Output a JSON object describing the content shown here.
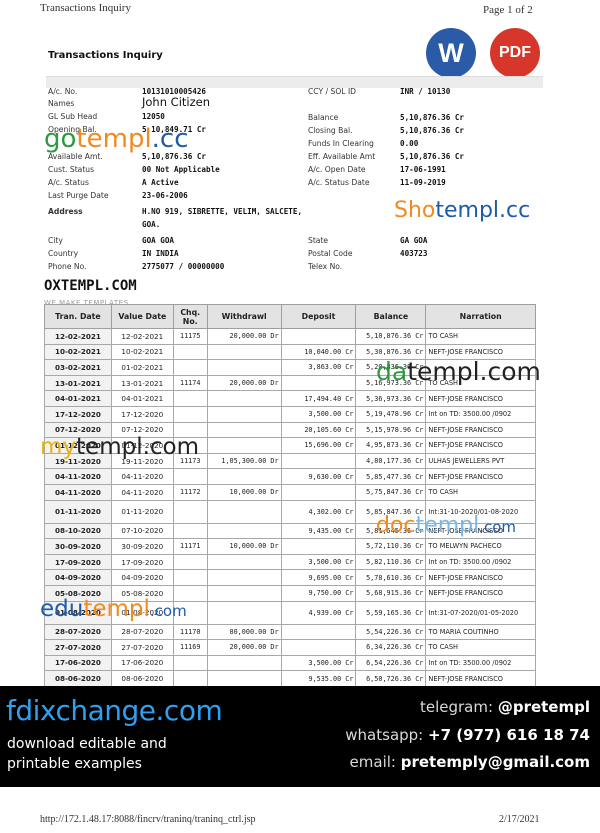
{
  "page": {
    "header": "Transactions Inquiry",
    "page_label": "Page 1 of 2",
    "footer_url": "http://172.1.48.17:8088/fincrv/traninq/traninq_ctrl.jsp",
    "footer_date": "2/17/2021"
  },
  "badges": {
    "word": "W",
    "pdf": "PDF"
  },
  "document": {
    "title": "Transactions Inquiry",
    "left": [
      {
        "label": "A/c. No.",
        "value": "10131010005426"
      },
      {
        "label": "Names",
        "value": "John Citizen"
      },
      {
        "label": "GL Sub Head",
        "value": "12050"
      },
      {
        "label": "Opening Bal.",
        "value": "5,10,849.71 Cr"
      },
      {
        "label": "Available Amt.",
        "value": "5,10,876.36 Cr"
      },
      {
        "label": "Cust. Status",
        "value": "00 Not Applicable"
      },
      {
        "label": "A/c. Status",
        "value": "A Active"
      },
      {
        "label": "Last Purge Date",
        "value": "23-06-2006"
      },
      {
        "label": "Address",
        "value": "H.NO 919, SIBRETTE, VELIM, SALCETE,"
      },
      {
        "label": "",
        "value": "GOA."
      },
      {
        "label": "City",
        "value": "GOA   GOA"
      },
      {
        "label": "Country",
        "value": "IN   INDIA"
      },
      {
        "label": "Phone No.",
        "value": "2775077 / 00000000"
      }
    ],
    "right": [
      {
        "label": "CCY / SOL ID",
        "value": "INR / 10130"
      },
      {
        "label": "Balance",
        "value": "5,10,876.36 Cr"
      },
      {
        "label": "Closing Bal.",
        "value": "5,10,876.36 Cr"
      },
      {
        "label": "Funds In Clearing",
        "value": "0.00"
      },
      {
        "label": "Eff. Available Amt",
        "value": "5,10,876.36 Cr"
      },
      {
        "label": "A/c. Open Date",
        "value": "17-06-1991"
      },
      {
        "label": "A/c. Status Date",
        "value": "11-09-2019"
      },
      {
        "label": "State",
        "value": "GA   GOA"
      },
      {
        "label": "Postal Code",
        "value": "403723"
      },
      {
        "label": "Telex No.",
        "value": ""
      }
    ]
  },
  "watermarks": {
    "gotempl_a": "go",
    "gotempl_b": "templ",
    "gotempl_c": ".cc",
    "shotempl_a": "Sho",
    "shotempl_b": "templ.cc",
    "oxtempl": "OXTEMPL.COM",
    "we_make": "WE MAKE TEMPLATES",
    "datempl_a": "da",
    "datempl_b": "templ.com",
    "mytempl_a": "my",
    "mytempl_b": "templ.com",
    "doctempl_a": "doc",
    "doctempl_b": "templ",
    "doctempl_c": ".com",
    "edutempl_a": "edu",
    "edutempl_b": "templ",
    "edutempl_c": ".com"
  },
  "table": {
    "headers": [
      "Tran. Date",
      "Value Date",
      "Chq. No.",
      "Withdrawl",
      "Deposit",
      "Balance",
      "Narration"
    ],
    "rows": [
      {
        "tran": "12-02-2021",
        "value": "12-02-2021",
        "chq": "11175",
        "wd": "20,000.00 Dr",
        "dep": "",
        "bal": "5,10,876.36 Cr",
        "narr": "TO CASH"
      },
      {
        "tran": "10-02-2021",
        "value": "10-02-2021",
        "chq": "",
        "wd": "",
        "dep": "10,040.00 Cr",
        "bal": "5,30,876.36 Cr",
        "narr": "NEFT-JOSE FRANCISCO"
      },
      {
        "tran": "03-02-2021",
        "value": "01-02-2021",
        "chq": "",
        "wd": "",
        "dep": "3,863.00 Cr",
        "bal": "5,20,836.36 Cr",
        "narr": ""
      },
      {
        "tran": "13-01-2021",
        "value": "13-01-2021",
        "chq": "11174",
        "wd": "20,000.00 Dr",
        "dep": "",
        "bal": "5,16,973.36 Cr",
        "narr": "TO CASH"
      },
      {
        "tran": "04-01-2021",
        "value": "04-01-2021",
        "chq": "",
        "wd": "",
        "dep": "17,494.40 Cr",
        "bal": "5,36,973.36 Cr",
        "narr": "NEFT-JOSE FRANCISCO"
      },
      {
        "tran": "17-12-2020",
        "value": "17-12-2020",
        "chq": "",
        "wd": "",
        "dep": "3,500.00 Cr",
        "bal": "5,19,478.96 Cr",
        "narr": "Int on TD: 3500.00 /0902"
      },
      {
        "tran": "07-12-2020",
        "value": "07-12-2020",
        "chq": "",
        "wd": "",
        "dep": "20,105.60 Cr",
        "bal": "5,15,978.96 Cr",
        "narr": "NEFT-JOSE FRANCISCO"
      },
      {
        "tran": "01-12-2020",
        "value": "01-12-2020",
        "chq": "",
        "wd": "",
        "dep": "15,696.00 Cr",
        "bal": "4,95,873.36 Cr",
        "narr": "NEFT-JOSE FRANCISCO"
      },
      {
        "tran": "19-11-2020",
        "value": "19-11-2020",
        "chq": "11173",
        "wd": "1,05,300.00 Dr",
        "dep": "",
        "bal": "4,80,177.36 Cr",
        "narr": "ULHAS JEWELLERS PVT"
      },
      {
        "tran": "04-11-2020",
        "value": "04-11-2020",
        "chq": "",
        "wd": "",
        "dep": "9,630.00 Cr",
        "bal": "5,85,477.36 Cr",
        "narr": "NEFT-JOSE FRANCISCO"
      },
      {
        "tran": "04-11-2020",
        "value": "04-11-2020",
        "chq": "11172",
        "wd": "10,000.00 Dr",
        "dep": "",
        "bal": "5,75,847.36 Cr",
        "narr": "TO CASH"
      },
      {
        "tran": "01-11-2020",
        "value": "01-11-2020",
        "chq": "",
        "wd": "",
        "dep": "4,302.00 Cr",
        "bal": "5,85,847.36 Cr",
        "narr": "Int:31-10-2020/01-08-2020",
        "tall": true
      },
      {
        "tran": "08-10-2020",
        "value": "07-10-2020",
        "chq": "",
        "wd": "",
        "dep": "9,435.00 Cr",
        "bal": "5,81,545.36 Cr",
        "narr": "NEFT-JOSE FRANCISCO"
      },
      {
        "tran": "30-09-2020",
        "value": "30-09-2020",
        "chq": "11171",
        "wd": "10,000.00 Dr",
        "dep": "",
        "bal": "5,72,110.36 Cr",
        "narr": "TO MELWYN PACHECO"
      },
      {
        "tran": "17-09-2020",
        "value": "17-09-2020",
        "chq": "",
        "wd": "",
        "dep": "3,500.00 Cr",
        "bal": "5,82,110.36 Cr",
        "narr": "Int on TD: 3500.00 /0902"
      },
      {
        "tran": "04-09-2020",
        "value": "04-09-2020",
        "chq": "",
        "wd": "",
        "dep": "9,695.00 Cr",
        "bal": "5,78,610.36 Cr",
        "narr": "NEFT-JOSE FRANCISCO"
      },
      {
        "tran": "05-08-2020",
        "value": "05-08-2020",
        "chq": "",
        "wd": "",
        "dep": "9,750.00 Cr",
        "bal": "5,68,915.36 Cr",
        "narr": "NEFT-JOSE FRANCISCO"
      },
      {
        "tran": "01-08-2020",
        "value": "01-08-2020",
        "chq": "",
        "wd": "",
        "dep": "4,939.00 Cr",
        "bal": "5,59,165.36 Cr",
        "narr": "Int:31-07-2020/01-05-2020",
        "tall": true
      },
      {
        "tran": "28-07-2020",
        "value": "28-07-2020",
        "chq": "11170",
        "wd": "80,000.00 Dr",
        "dep": "",
        "bal": "5,54,226.36 Cr",
        "narr": "TO MARIA COUTINHO"
      },
      {
        "tran": "27-07-2020",
        "value": "27-07-2020",
        "chq": "11169",
        "wd": "20,000.00 Dr",
        "dep": "",
        "bal": "6,34,226.36 Cr",
        "narr": "TO CASH"
      },
      {
        "tran": "17-06-2020",
        "value": "17-06-2020",
        "chq": "",
        "wd": "",
        "dep": "3,500.00 Cr",
        "bal": "6,54,226.36 Cr",
        "narr": "Int on TD: 3500.00 /0902"
      },
      {
        "tran": "08-06-2020",
        "value": "08-06-2020",
        "chq": "",
        "wd": "",
        "dep": "9,535.00 Cr",
        "bal": "6,50,726.36 Cr",
        "narr": "NEFT-JOSE FRANCISCO"
      }
    ]
  },
  "banner": {
    "brand": "fdixchange.com",
    "tagline_1": "download editable and",
    "tagline_2": "printable examples",
    "telegram_label": "telegram:",
    "telegram_value": "@pretempl",
    "whatsapp_label": "whatsapp:",
    "whatsapp_value": "+7 (977) 616 18 74",
    "email_label": "email:",
    "email_value": "pretemply@gmail.com"
  }
}
